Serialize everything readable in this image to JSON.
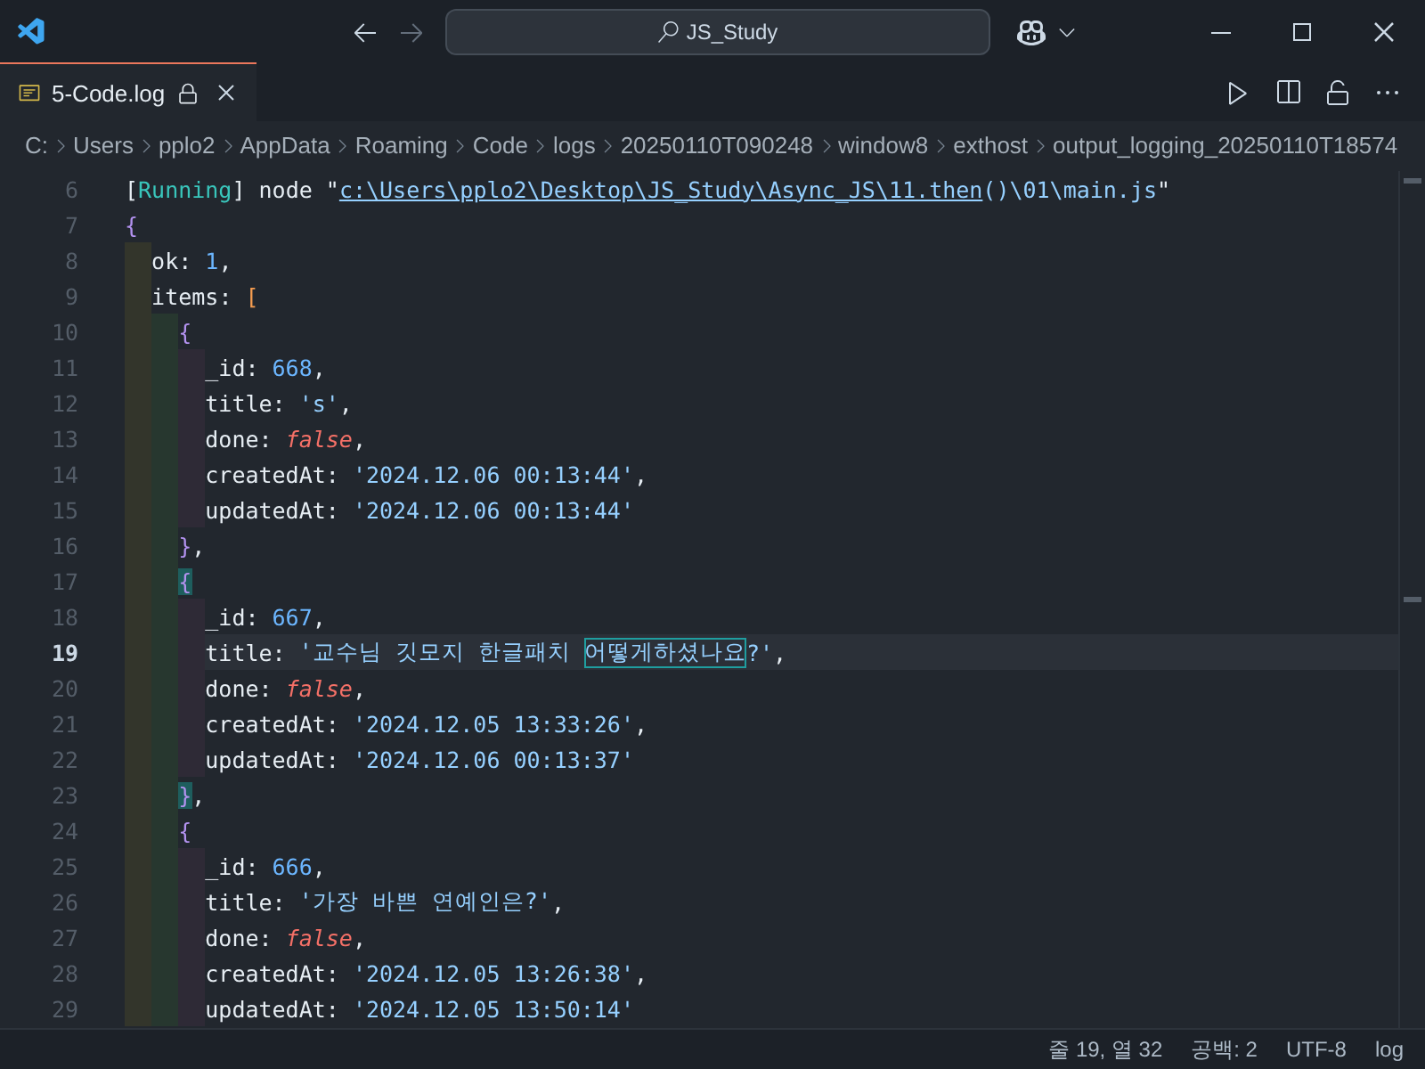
{
  "titlebar": {
    "search": "JS_Study"
  },
  "tabs": [
    {
      "label": "5-Code.log",
      "selected": true
    }
  ],
  "breadcrumb": [
    "C:",
    "Users",
    "pplo2",
    "AppData",
    "Roaming",
    "Code",
    "logs",
    "20250110T090248",
    "window8",
    "exthost",
    "output_logging_20250110T18574"
  ],
  "lines": [
    {
      "number": "6",
      "selected": false,
      "tokens": [
        {
          "kind": "punct",
          "text": "["
        },
        {
          "kind": "tag",
          "text": "Running"
        },
        {
          "kind": "punct",
          "text": "] node \""
        },
        {
          "kind": "link",
          "text": "c:\\Users\\pplo2\\Desktop\\JS_Study\\Async_JS\\11.then"
        },
        {
          "kind": "string",
          "text": "()\\01\\main.js"
        },
        {
          "kind": "punct",
          "text": "\""
        }
      ]
    },
    {
      "number": "7",
      "selected": false,
      "tokens": [
        {
          "kind": "brace",
          "text": "{"
        }
      ],
      "children": [
        {
          "number": "8",
          "selected": false,
          "tokens": [
            {
              "kind": "key",
              "text": "ok"
            },
            {
              "kind": "punct",
              "text": ": "
            },
            {
              "kind": "number",
              "text": "1"
            },
            {
              "kind": "punct",
              "text": ","
            }
          ]
        },
        {
          "number": "9",
          "selected": false,
          "tokens": [
            {
              "kind": "key",
              "text": "items"
            },
            {
              "kind": "punct",
              "text": ": "
            },
            {
              "kind": "bracket",
              "text": "["
            }
          ],
          "children": [
            {
              "number": "10",
              "selected": false,
              "tokens": [
                {
                  "kind": "brace",
                  "text": "{"
                }
              ],
              "children": [
                {
                  "number": "11",
                  "selected": false,
                  "tokens": [
                    {
                      "kind": "key",
                      "text": "_id"
                    },
                    {
                      "kind": "punct",
                      "text": ": "
                    },
                    {
                      "kind": "number",
                      "text": "668"
                    },
                    {
                      "kind": "punct",
                      "text": ","
                    }
                  ]
                },
                {
                  "number": "12",
                  "selected": false,
                  "tokens": [
                    {
                      "kind": "key",
                      "text": "title"
                    },
                    {
                      "kind": "punct",
                      "text": ": "
                    },
                    {
                      "kind": "string",
                      "text": "'s'"
                    },
                    {
                      "kind": "punct",
                      "text": ","
                    }
                  ]
                },
                {
                  "number": "13",
                  "selected": false,
                  "tokens": [
                    {
                      "kind": "key",
                      "text": "done"
                    },
                    {
                      "kind": "punct",
                      "text": ": "
                    },
                    {
                      "kind": "keyword",
                      "text": "false"
                    },
                    {
                      "kind": "punct",
                      "text": ","
                    }
                  ]
                },
                {
                  "number": "14",
                  "selected": false,
                  "tokens": [
                    {
                      "kind": "key",
                      "text": "createdAt"
                    },
                    {
                      "kind": "punct",
                      "text": ": "
                    },
                    {
                      "kind": "string",
                      "text": "'2024.12.06 00:13:44'"
                    },
                    {
                      "kind": "punct",
                      "text": ","
                    }
                  ]
                },
                {
                  "number": "15",
                  "selected": false,
                  "tokens": [
                    {
                      "kind": "key",
                      "text": "updatedAt"
                    },
                    {
                      "kind": "punct",
                      "text": ": "
                    },
                    {
                      "kind": "string",
                      "text": "'2024.12.06 00:13:44'"
                    }
                  ]
                }
              ]
            },
            {
              "number": "16",
              "selected": false,
              "tokens": [
                {
                  "kind": "brace",
                  "text": "}"
                },
                {
                  "kind": "punct",
                  "text": ","
                }
              ]
            },
            {
              "number": "17",
              "selected": false,
              "tokens": [
                {
                  "kind": "brace-match",
                  "text": "{"
                }
              ],
              "children": [
                {
                  "number": "18",
                  "selected": false,
                  "tokens": [
                    {
                      "kind": "key",
                      "text": "_id"
                    },
                    {
                      "kind": "punct",
                      "text": ": "
                    },
                    {
                      "kind": "number",
                      "text": "667"
                    },
                    {
                      "kind": "punct",
                      "text": ","
                    }
                  ]
                },
                {
                  "number": "19",
                  "selected": true,
                  "tokens": [
                    {
                      "kind": "key",
                      "text": "title"
                    },
                    {
                      "kind": "punct",
                      "text": ": "
                    },
                    {
                      "kind": "string",
                      "text": "'교수님 깃모지 한글패치 "
                    },
                    {
                      "kind": "match",
                      "text": "어떻게하셨나요"
                    },
                    {
                      "kind": "string",
                      "text": "?'"
                    },
                    {
                      "kind": "punct",
                      "text": ","
                    }
                  ]
                },
                {
                  "number": "20",
                  "selected": false,
                  "tokens": [
                    {
                      "kind": "key",
                      "text": "done"
                    },
                    {
                      "kind": "punct",
                      "text": ": "
                    },
                    {
                      "kind": "keyword",
                      "text": "false"
                    },
                    {
                      "kind": "punct",
                      "text": ","
                    }
                  ]
                },
                {
                  "number": "21",
                  "selected": false,
                  "tokens": [
                    {
                      "kind": "key",
                      "text": "createdAt"
                    },
                    {
                      "kind": "punct",
                      "text": ": "
                    },
                    {
                      "kind": "string",
                      "text": "'2024.12.05 13:33:26'"
                    },
                    {
                      "kind": "punct",
                      "text": ","
                    }
                  ]
                },
                {
                  "number": "22",
                  "selected": false,
                  "tokens": [
                    {
                      "kind": "key",
                      "text": "updatedAt"
                    },
                    {
                      "kind": "punct",
                      "text": ": "
                    },
                    {
                      "kind": "string",
                      "text": "'2024.12.06 00:13:37'"
                    }
                  ]
                }
              ]
            },
            {
              "number": "23",
              "selected": false,
              "tokens": [
                {
                  "kind": "brace-match",
                  "text": "}"
                },
                {
                  "kind": "punct",
                  "text": ","
                }
              ]
            },
            {
              "number": "24",
              "selected": false,
              "tokens": [
                {
                  "kind": "brace",
                  "text": "{"
                }
              ],
              "children": [
                {
                  "number": "25",
                  "selected": false,
                  "tokens": [
                    {
                      "kind": "key",
                      "text": "_id"
                    },
                    {
                      "kind": "punct",
                      "text": ": "
                    },
                    {
                      "kind": "number",
                      "text": "666"
                    },
                    {
                      "kind": "punct",
                      "text": ","
                    }
                  ]
                },
                {
                  "number": "26",
                  "selected": false,
                  "tokens": [
                    {
                      "kind": "key",
                      "text": "title"
                    },
                    {
                      "kind": "punct",
                      "text": ": "
                    },
                    {
                      "kind": "string",
                      "text": "'가장 바쁜 연예인은?'"
                    },
                    {
                      "kind": "punct",
                      "text": ","
                    }
                  ]
                },
                {
                  "number": "27",
                  "selected": false,
                  "tokens": [
                    {
                      "kind": "key",
                      "text": "done"
                    },
                    {
                      "kind": "punct",
                      "text": ": "
                    },
                    {
                      "kind": "keyword",
                      "text": "false"
                    },
                    {
                      "kind": "punct",
                      "text": ","
                    }
                  ]
                },
                {
                  "number": "28",
                  "selected": false,
                  "tokens": [
                    {
                      "kind": "key",
                      "text": "createdAt"
                    },
                    {
                      "kind": "punct",
                      "text": ": "
                    },
                    {
                      "kind": "string",
                      "text": "'2024.12.05 13:26:38'"
                    },
                    {
                      "kind": "punct",
                      "text": ","
                    }
                  ]
                },
                {
                  "number": "29",
                  "selected": false,
                  "tokens": [
                    {
                      "kind": "key",
                      "text": "updatedAt"
                    },
                    {
                      "kind": "punct",
                      "text": ": "
                    },
                    {
                      "kind": "string",
                      "text": "'2024.12.05 13:50:14'"
                    }
                  ]
                }
              ]
            }
          ]
        }
      ]
    }
  ],
  "status_bar": [
    "줄 19, 열 32",
    "공백: 2",
    "UTF-8",
    "log"
  ]
}
